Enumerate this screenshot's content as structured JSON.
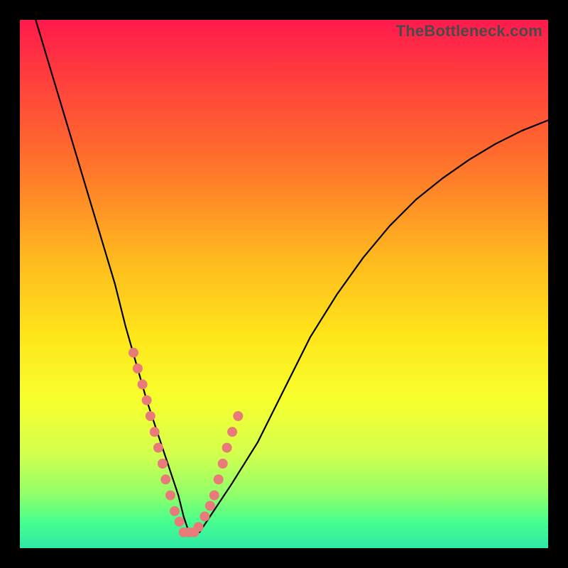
{
  "watermark": "TheBottleneck.com",
  "chart_data": {
    "type": "line",
    "title": "",
    "xlabel": "",
    "ylabel": "",
    "xlim": [
      0,
      100
    ],
    "ylim": [
      0,
      100
    ],
    "grid": false,
    "background_gradient": {
      "top": "#ff1a4d",
      "middle": "#ffe61a",
      "bottom": "#2fe8a6"
    },
    "series": [
      {
        "name": "bottleneck-curve",
        "x": [
          3,
          6,
          9,
          12,
          15,
          18,
          20,
          22,
          24,
          26,
          28,
          30,
          31,
          32,
          34,
          36,
          40,
          45,
          50,
          55,
          60,
          65,
          70,
          75,
          80,
          85,
          90,
          95,
          100
        ],
        "y": [
          100,
          90,
          80,
          70,
          60,
          50,
          42,
          35,
          28,
          22,
          16,
          10,
          6,
          3,
          3,
          6,
          12,
          20,
          30,
          40,
          48,
          55,
          61,
          66,
          70,
          73.5,
          76.5,
          79,
          81
        ]
      }
    ],
    "markers": [
      {
        "name": "salmon-dots",
        "x": [
          21.5,
          22.3,
          23.2,
          24.0,
          24.7,
          25.5,
          26.2,
          27.0,
          27.6,
          28.5,
          29.3,
          30.2,
          31.0,
          32.0,
          33.0,
          33.8,
          35.0,
          36.0,
          36.8,
          37.6,
          38.4,
          39.2,
          40.2,
          41.3
        ],
        "y": [
          37,
          34,
          31,
          28,
          25,
          22,
          19,
          16,
          13,
          10,
          7,
          5,
          3,
          3,
          3,
          4,
          6,
          8,
          10,
          13,
          16,
          19,
          22,
          25
        ]
      }
    ]
  }
}
